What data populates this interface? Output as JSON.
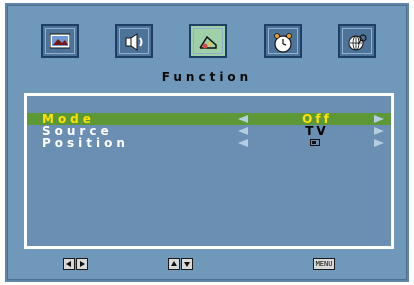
{
  "header": {
    "title": "Function"
  },
  "tabs": [
    {
      "icon": "picture-icon"
    },
    {
      "icon": "speaker-icon"
    },
    {
      "icon": "function-icon",
      "active": true
    },
    {
      "icon": "clock-icon"
    },
    {
      "icon": "globe-key-icon"
    }
  ],
  "menu": {
    "items": [
      {
        "label": "Mode",
        "value": "Off",
        "selected": true
      },
      {
        "label": "Source",
        "value": "TV"
      },
      {
        "label": "Position",
        "value_icon": "position-icon"
      }
    ]
  },
  "footer": {
    "hints": [
      "left-right-keys",
      "up-down-keys"
    ],
    "menu_key": "MENU"
  },
  "colors": {
    "background": "#6f98ba",
    "selected_row": "#5c9936",
    "selected_text": "#ffe200",
    "active_tab": "#9fd0a8"
  }
}
